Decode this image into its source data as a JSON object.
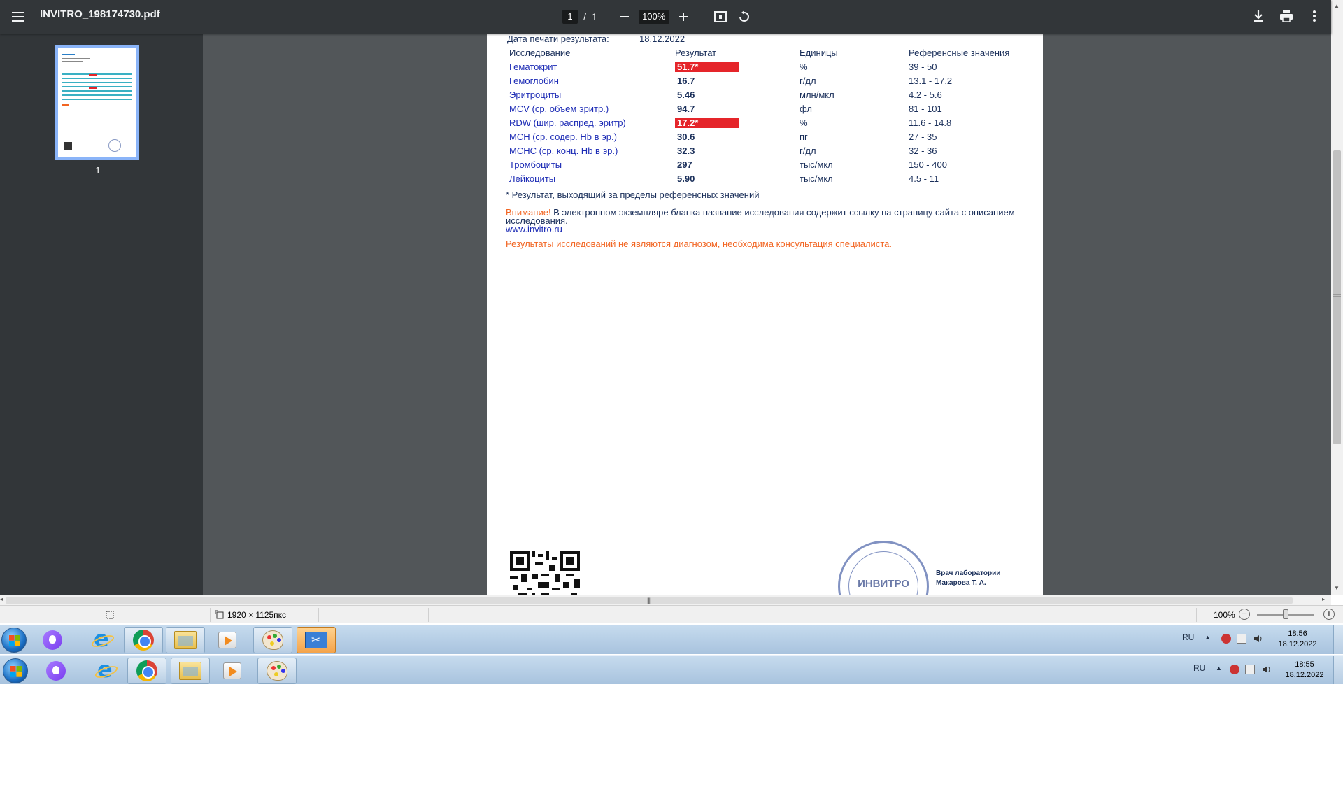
{
  "viewer": {
    "file_name": "INVITRO_198174730.pdf",
    "current_page": "1",
    "page_sep": "/",
    "total_pages": "1",
    "zoom": "100%",
    "thumb_label": "1"
  },
  "report": {
    "print_label": "Дата печати результата:",
    "print_date": "18.12.2022",
    "headers": {
      "test": "Исследование",
      "result": "Результат",
      "units": "Единицы",
      "reference": "Референсные значения"
    },
    "rows": [
      {
        "test": "Гематокрит",
        "result": "51.7*",
        "flag": true,
        "units": "%",
        "reference": "39 - 50"
      },
      {
        "test": "Гемоглобин",
        "result": "16.7",
        "flag": false,
        "units": "г/дл",
        "reference": "13.1 - 17.2"
      },
      {
        "test": "Эритроциты",
        "result": "5.46",
        "flag": false,
        "units": "млн/мкл",
        "reference": "4.2 - 5.6"
      },
      {
        "test": "MCV (ср. объем эритр.)",
        "result": "94.7",
        "flag": false,
        "units": "фл",
        "reference": "81 - 101"
      },
      {
        "test": "RDW (шир. распред. эритр)",
        "result": "17.2*",
        "flag": true,
        "units": "%",
        "reference": "11.6 - 14.8"
      },
      {
        "test": "MCH (ср. содер. Hb в эр.)",
        "result": "30.6",
        "flag": false,
        "units": "пг",
        "reference": "27 - 35"
      },
      {
        "test": "MCHC (ср. конц. Hb в эр.)",
        "result": "32.3",
        "flag": false,
        "units": "г/дл",
        "reference": "32 - 36"
      },
      {
        "test": "Тромбоциты",
        "result": "297",
        "flag": false,
        "units": "тыс/мкл",
        "reference": "150 - 400"
      },
      {
        "test": "Лейкоциты",
        "result": "5.90",
        "flag": false,
        "units": "тыс/мкл",
        "reference": "4.5 - 11"
      }
    ],
    "footnote": "* Результат, выходящий за пределы референсных значений",
    "warning_label": "Внимание!",
    "warning_text": " В электронном экземпляре бланка название исследования содержит ссылку на страницу сайта с описанием исследования.",
    "website": "www.invitro.ru",
    "disclaimer": "Результаты исследований не являются диагнозом, необходима консультация специалиста.",
    "stamp_text": "ИНВИТРО",
    "doctor_title": "Врач лаборатории",
    "doctor_name": "Макарова Т. А."
  },
  "status_bar": {
    "dimensions": "1920 × 1125пкс",
    "zoom": "100%"
  },
  "taskbar_top": {
    "lang": "RU",
    "time": "18:56",
    "date": "18.12.2022"
  },
  "taskbar_bottom": {
    "lang": "RU",
    "time": "18:55",
    "date": "18.12.2022"
  },
  "colors": {
    "toolbar_bg": "#323639",
    "viewer_bg": "#525659",
    "flag_red": "#e5252a",
    "table_rule": "#3aa0b0",
    "link_blue": "#1c2bb5",
    "warning_orange": "#f26522"
  }
}
